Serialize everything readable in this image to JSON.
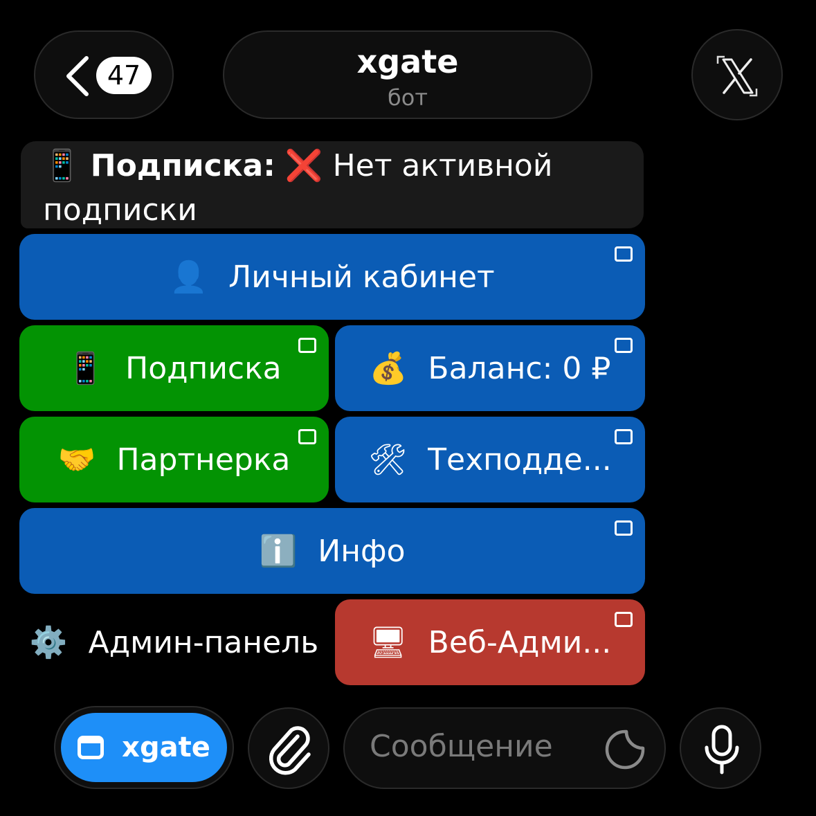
{
  "header": {
    "unread_count": "47",
    "chat_title": "xgate",
    "chat_subtitle": "бот"
  },
  "message": {
    "icon": "📱",
    "label": "Подписка:",
    "status_icon": "❌",
    "status_text": "Нет активной подписки"
  },
  "keyboard": {
    "cabinet": {
      "emoji": "👤",
      "label": "Личный кабинет"
    },
    "subscription": {
      "emoji": "📱",
      "label": "Подписка"
    },
    "balance": {
      "emoji": "💰",
      "label": "Баланс: 0 ₽"
    },
    "partner": {
      "emoji": "🤝",
      "label": "Партнерка"
    },
    "support": {
      "emoji": "🛠",
      "label": "Техподде..."
    },
    "info": {
      "emoji": "ℹ️",
      "label": "Инфо"
    },
    "admin": {
      "emoji": "⚙️",
      "label": "Админ-панель"
    },
    "webadmin": {
      "emoji": "🖥",
      "label": "Веб-Адми..."
    }
  },
  "colors": {
    "blue_button": "#0b5cb5",
    "green_button": "#039303",
    "red_button": "#b7392f",
    "menu_button": "#1e8ff8"
  },
  "bottom_bar": {
    "menu_label": "xgate",
    "input_placeholder": "Сообщение"
  }
}
